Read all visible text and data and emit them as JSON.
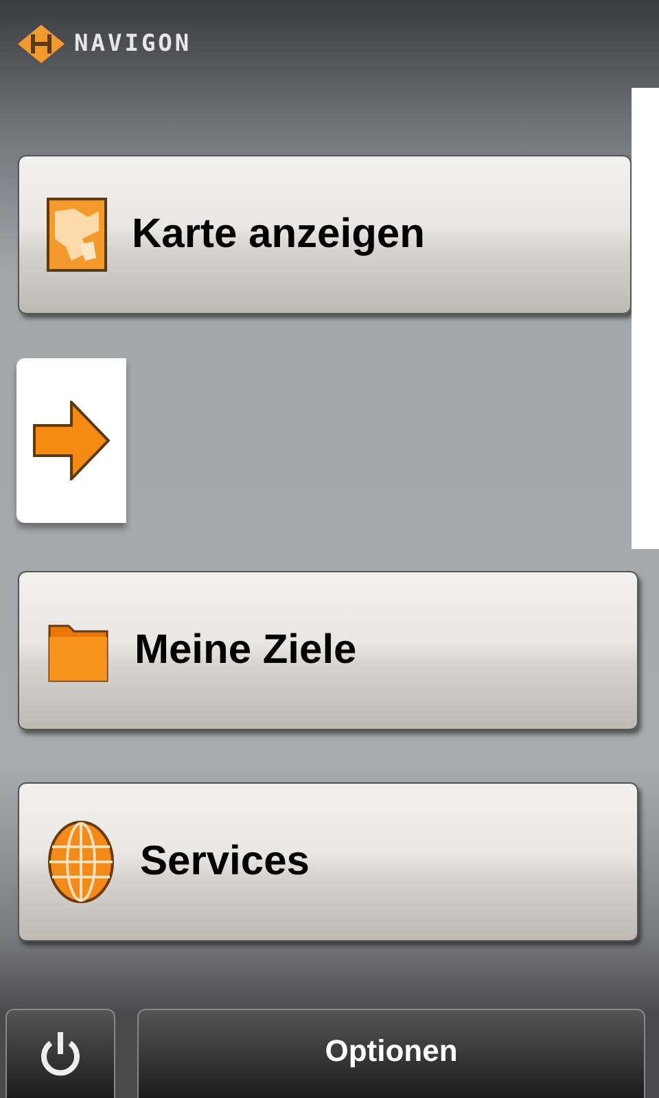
{
  "header": {
    "logo": "NAVIGON"
  },
  "menu": [
    {
      "kind": "map",
      "label": "Karte anzeigen"
    },
    {
      "kind": "arrow"
    },
    {
      "kind": "folder",
      "label": "Meine Ziele"
    },
    {
      "kind": "globe",
      "label": "Services"
    }
  ],
  "bottom_bar": {
    "options_button": "Optionen"
  }
}
